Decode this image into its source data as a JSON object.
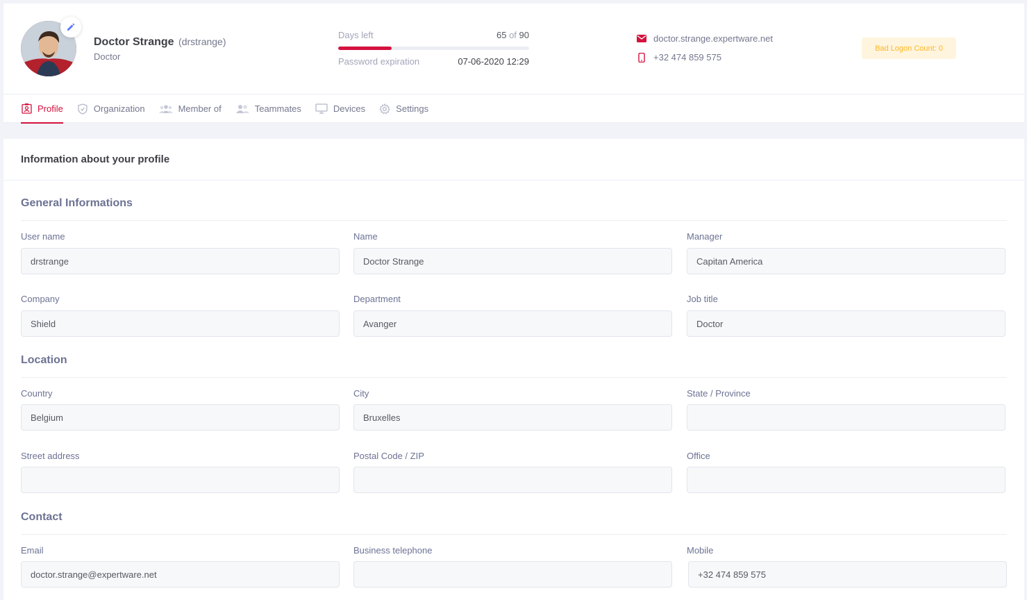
{
  "user": {
    "display_name": "Doctor Strange",
    "login": "(drstrange)",
    "role": "Doctor"
  },
  "stats": {
    "days_left_label": "Days left",
    "days_left": "65",
    "of_word": "of",
    "days_total": "90",
    "days_fraction": 0.28,
    "password_expiration_label": "Password expiration",
    "password_expiration": "07-06-2020 12:29"
  },
  "contact": {
    "website": "doctor.strange.expertware.net",
    "phone": "+32 474 859 575"
  },
  "badge": {
    "label": "Bad Logon Count: 0"
  },
  "tabs": [
    {
      "label": "Profile",
      "icon": "profile-icon"
    },
    {
      "label": "Organization",
      "icon": "shield-icon"
    },
    {
      "label": "Member of",
      "icon": "group-icon"
    },
    {
      "label": "Teammates",
      "icon": "users-icon"
    },
    {
      "label": "Devices",
      "icon": "monitor-icon"
    },
    {
      "label": "Settings",
      "icon": "gear-icon"
    }
  ],
  "colors": {
    "accent": "#d4123e",
    "warning": "#ffb822",
    "edit": "#5d78ff"
  },
  "page": {
    "heading": "Information about your profile"
  },
  "sections": {
    "general": {
      "title": "General Informations",
      "fields": {
        "username": {
          "label": "User name",
          "value": "drstrange"
        },
        "name": {
          "label": "Name",
          "value": "Doctor Strange"
        },
        "manager": {
          "label": "Manager",
          "value": "Capitan America"
        },
        "company": {
          "label": "Company",
          "value": "Shield"
        },
        "department": {
          "label": "Department",
          "value": "Avanger"
        },
        "job_title": {
          "label": "Job title",
          "value": "Doctor"
        }
      }
    },
    "location": {
      "title": "Location",
      "fields": {
        "country": {
          "label": "Country",
          "value": "Belgium"
        },
        "city": {
          "label": "City",
          "value": "Bruxelles"
        },
        "state": {
          "label": "State / Province",
          "value": ""
        },
        "street": {
          "label": "Street address",
          "value": ""
        },
        "postal": {
          "label": "Postal Code / ZIP",
          "value": ""
        },
        "office": {
          "label": "Office",
          "value": ""
        }
      }
    },
    "contact": {
      "title": "Contact",
      "fields": {
        "email": {
          "label": "Email",
          "value": "doctor.strange@expertware.net"
        },
        "business_phone": {
          "label": "Business telephone",
          "value": ""
        },
        "mobile": {
          "label": "Mobile",
          "value": "+32 474 859 575"
        }
      }
    }
  }
}
